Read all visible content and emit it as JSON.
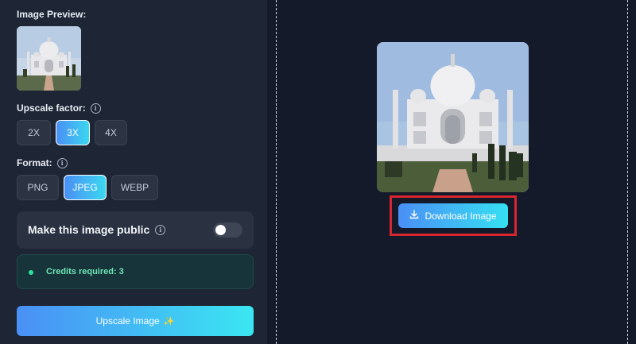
{
  "preview": {
    "label": "Image Preview:"
  },
  "upscale": {
    "label": "Upscale factor:",
    "options": [
      "2X",
      "3X",
      "4X"
    ],
    "selected": "3X"
  },
  "format": {
    "label": "Format:",
    "options": [
      "PNG",
      "JPEG",
      "WEBP"
    ],
    "selected": "JPEG"
  },
  "public_toggle": {
    "label": "Make this image public",
    "enabled": false
  },
  "credits": {
    "text": "Credits required: 3"
  },
  "upscale_button": {
    "label": "Upscale Image",
    "icon": "sparkles-icon"
  },
  "download_button": {
    "label": "Download Image",
    "icon": "download-icon"
  },
  "colors": {
    "accent_start": "#4a8ff5",
    "accent_end": "#3be6f2",
    "highlight": "#d6262f",
    "credits_green": "#6ee6b6"
  }
}
